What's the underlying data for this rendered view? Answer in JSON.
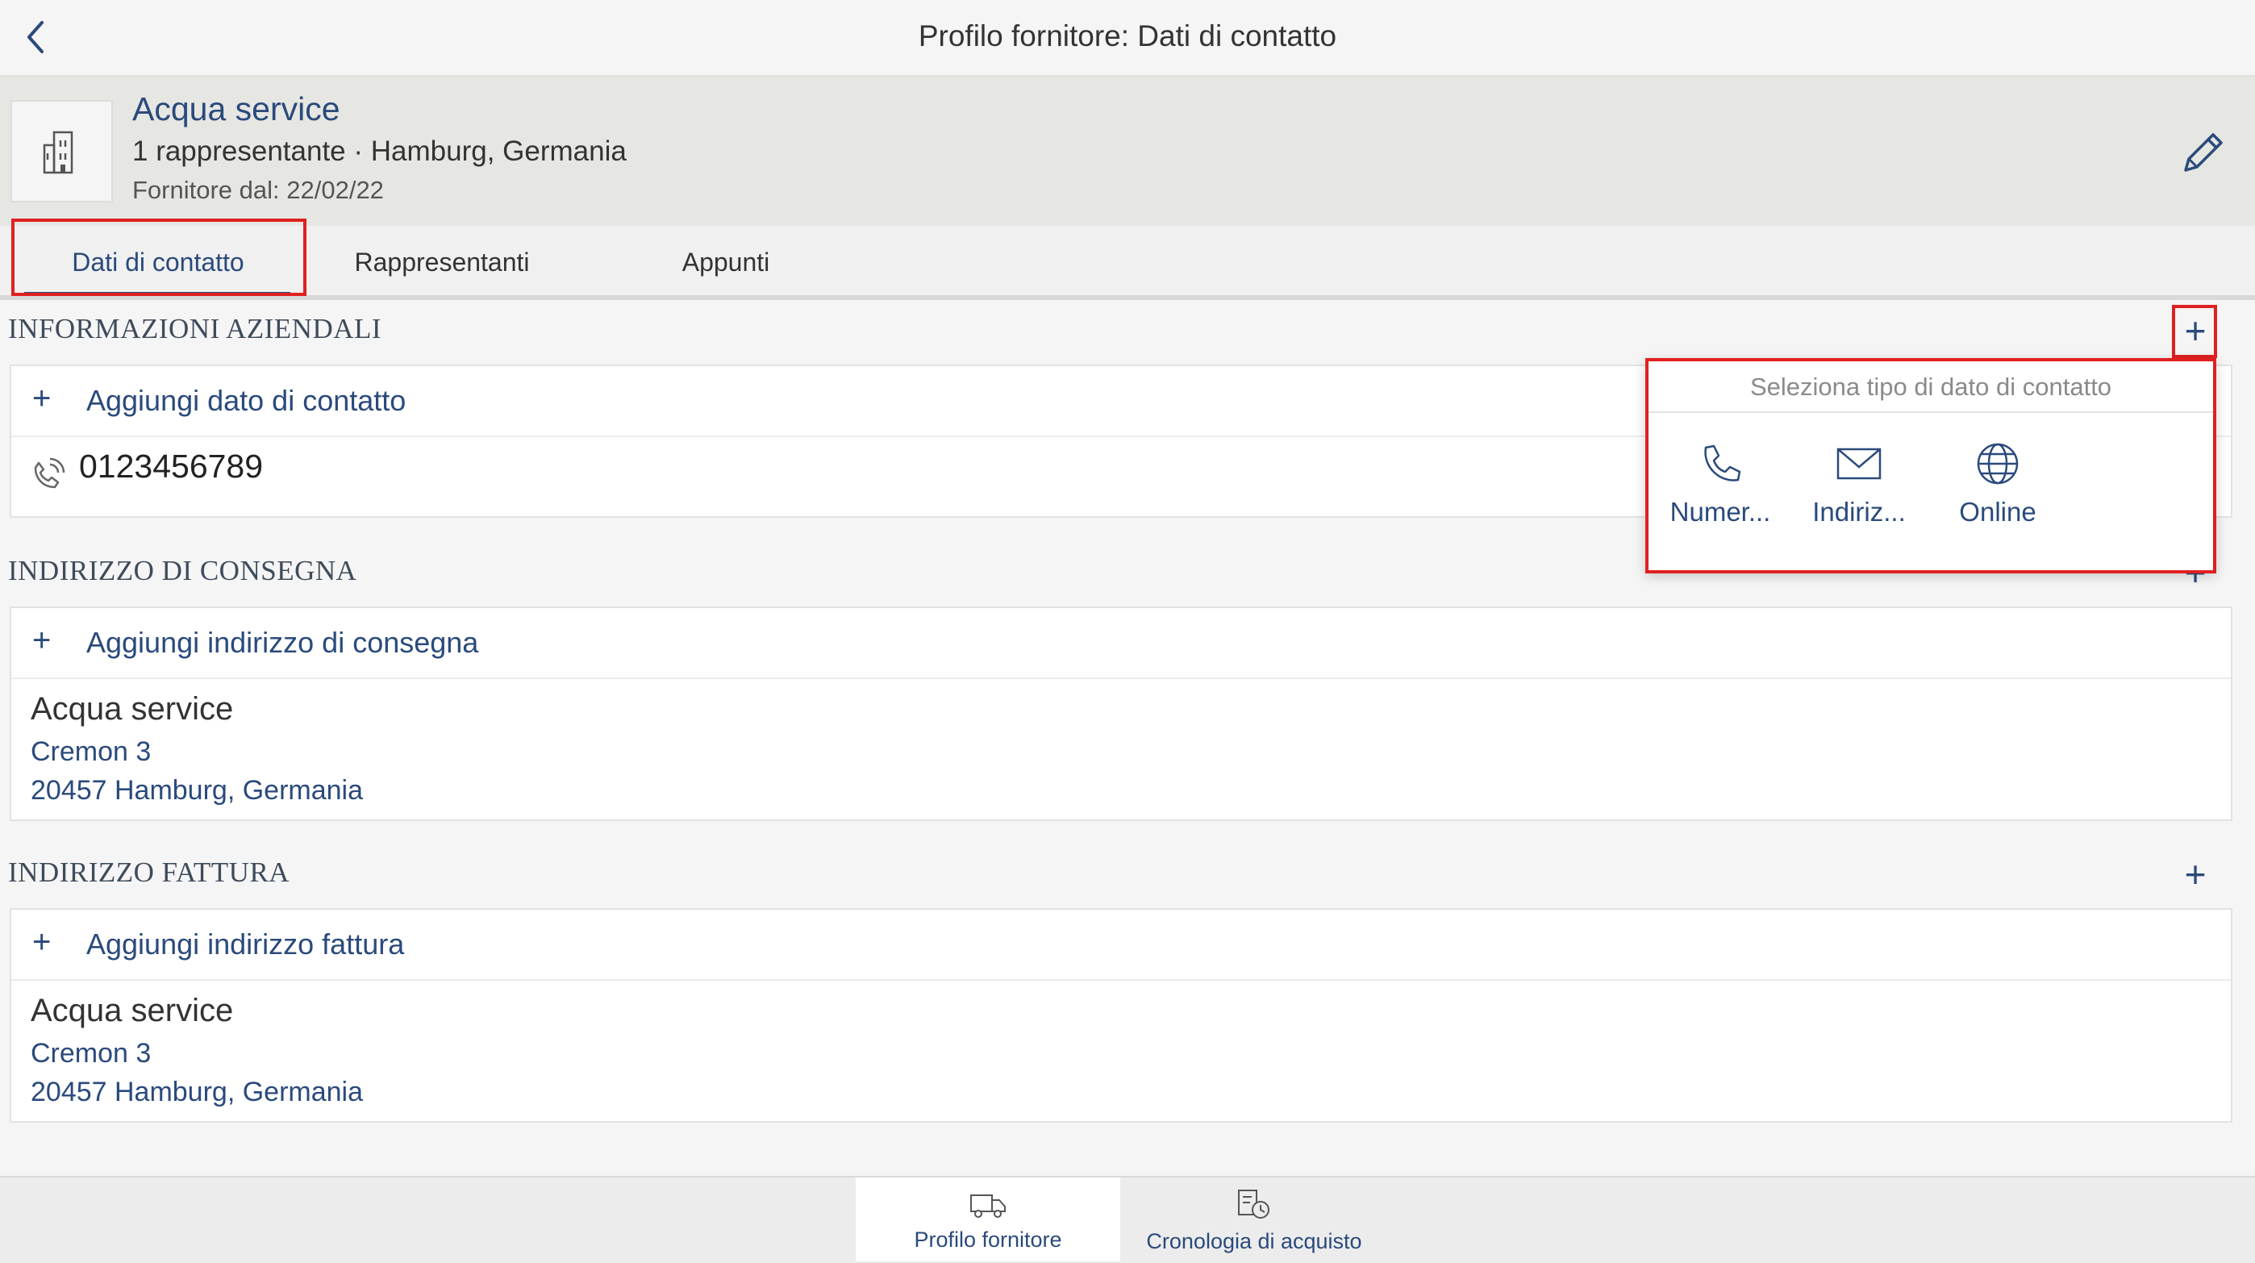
{
  "nav": {
    "title": "Profilo fornitore: Dati di contatto"
  },
  "supplier": {
    "name": "Acqua service",
    "subtitle": "1 rappresentante · Hamburg, Germania",
    "since": "Fornitore dal: 22/02/22"
  },
  "tabs": [
    {
      "label": "Dati di contatto"
    },
    {
      "label": "Rappresentanti"
    },
    {
      "label": "Appunti"
    }
  ],
  "sections": {
    "company": {
      "title": "INFORMAZIONI AZIENDALI",
      "add_label": "Aggiungi dato di contatto",
      "phone": "0123456789"
    },
    "delivery": {
      "title": "INDIRIZZO DI CONSEGNA",
      "add_label": "Aggiungi indirizzo di consegna",
      "name": "Acqua service",
      "street": "Cremon 3",
      "city": "20457 Hamburg, Germania"
    },
    "invoice": {
      "title": "INDIRIZZO FATTURA",
      "add_label": "Aggiungi indirizzo fattura",
      "name": "Acqua service",
      "street": "Cremon 3",
      "city": "20457 Hamburg, Germania"
    }
  },
  "popover": {
    "header": "Seleziona tipo di dato di contatto",
    "items": [
      {
        "label": "Numer...",
        "icon": "phone-icon"
      },
      {
        "label": "Indiriz...",
        "icon": "mail-icon"
      },
      {
        "label": "Online",
        "icon": "globe-icon"
      }
    ]
  },
  "bottom_tabs": [
    {
      "label": "Profilo fornitore",
      "icon": "supplier-truck-icon"
    },
    {
      "label": "Cronologia di acquisto",
      "icon": "purchase-history-icon"
    }
  ],
  "colors": {
    "accent": "#2a4a7c",
    "highlight": "#e02020"
  }
}
